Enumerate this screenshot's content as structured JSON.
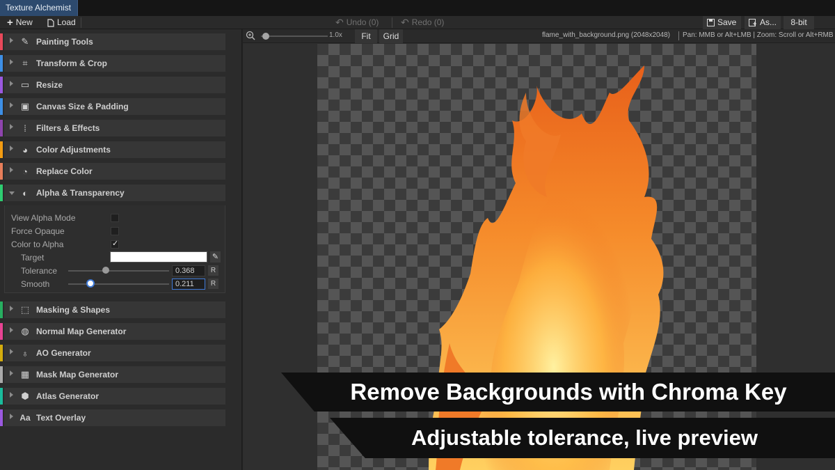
{
  "app": {
    "tab_title": "Texture Alchemist"
  },
  "toolbar": {
    "new_label": "New",
    "load_label": "Load",
    "undo_label": "Undo (0)",
    "redo_label": "Redo (0)",
    "save_label": "Save",
    "save_as_label": "As...",
    "bitdepth_label": "8-bit"
  },
  "viewer": {
    "zoom_label": "1.0x",
    "fit_label": "Fit",
    "grid_label": "Grid",
    "file_info": "flame_with_background.png (2048x2048)",
    "help_text": "Pan: MMB or Alt+LMB | Zoom: Scroll or Alt+RMB",
    "zoom_slider_level": 0.05
  },
  "sections": [
    {
      "label": "Painting Tools",
      "icon": "brush-icon",
      "color": "#e8485a"
    },
    {
      "label": "Transform & Crop",
      "icon": "crop-icon",
      "color": "#3d8fe6"
    },
    {
      "label": "Resize",
      "icon": "resize-icon",
      "color": "#9b59e0"
    },
    {
      "label": "Canvas Size & Padding",
      "icon": "canvas-icon",
      "color": "#3d8fe6"
    },
    {
      "label": "Filters & Effects",
      "icon": "filter-grid-icon",
      "color": "#8e44ad"
    },
    {
      "label": "Color Adjustments",
      "icon": "palette-icon",
      "color": "#f39c12"
    },
    {
      "label": "Replace Color",
      "icon": "replace-color-icon",
      "color": "#e67e5a"
    },
    {
      "label": "Alpha & Transparency",
      "icon": "alpha-icon",
      "color": "#2ecc71"
    },
    {
      "label": "Masking & Shapes",
      "icon": "mask-icon",
      "color": "#27ae60"
    },
    {
      "label": "Normal Map Generator",
      "icon": "normal-map-icon",
      "color": "#e84393"
    },
    {
      "label": "AO Generator",
      "icon": "bulb-icon",
      "color": "#d4ac0d"
    },
    {
      "label": "Mask Map Generator",
      "icon": "checker-icon",
      "color": "#aaaaaa"
    },
    {
      "label": "Atlas Generator",
      "icon": "cube-icon",
      "color": "#1abc9c"
    },
    {
      "label": "Text Overlay",
      "icon": "text-icon",
      "color": "#9b59e0"
    }
  ],
  "alpha": {
    "view_alpha_label": "View Alpha Mode",
    "view_alpha_checked": false,
    "force_opaque_label": "Force Opaque",
    "force_opaque_checked": false,
    "color_to_alpha_label": "Color to Alpha",
    "color_to_alpha_checked": true,
    "target_label": "Target",
    "target_color": "#ffffff",
    "tolerance_label": "Tolerance",
    "tolerance_value": "0.368",
    "smooth_label": "Smooth",
    "smooth_value": "0.211",
    "reset_label": "R"
  },
  "banners": {
    "headline": "Remove Backgrounds with Chroma Key",
    "subline": "Adjustable tolerance, live preview"
  }
}
